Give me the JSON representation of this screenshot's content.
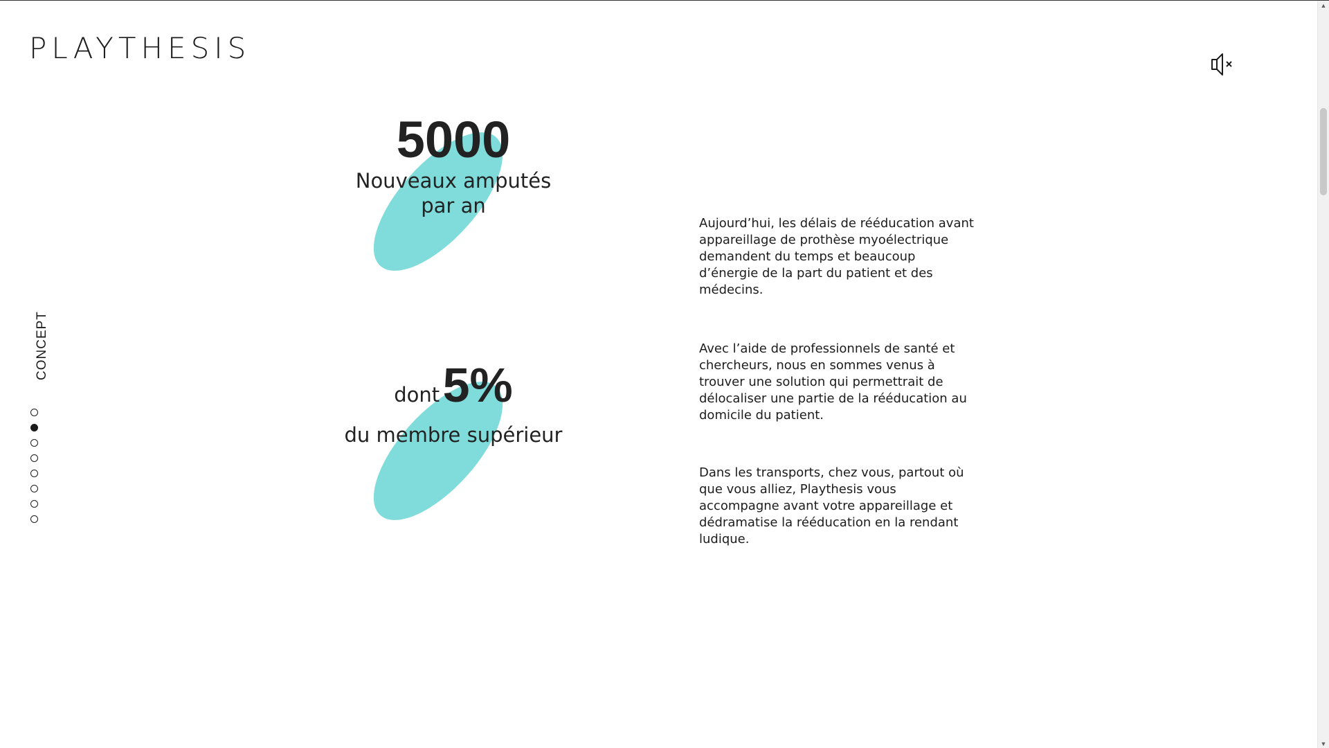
{
  "header": {
    "logo_text": "PLAYTHESIS",
    "sound_icon": "speaker-muted-icon"
  },
  "nav": {
    "section_label": "CONCEPT",
    "dots_total": 8,
    "active_index": 1
  },
  "stats": {
    "stat1": {
      "number": "5000",
      "label": "Nouveaux amputés par an"
    },
    "stat2": {
      "prefix": "dont",
      "number": "5%",
      "label": "du membre supérieur"
    }
  },
  "paragraphs": {
    "p1": "Aujourd’hui, les délais de rééducation avant appareillage de prothèse myoélectrique demandent du temps et beaucoup d’énergie de la part du patient et des médecins.",
    "p2": "Avec l’aide de professionnels de santé et chercheurs, nous en sommes venus à trouver une solution qui permettrait de délocaliser une partie de la rééducation au domicile du patient.",
    "p3": "Dans les transports, chez vous, partout où que vous alliez, Playthesis vous accompagne avant votre appareillage et dédramatise la rééducation en la rendant ludique."
  },
  "colors": {
    "accent": "#7fdcdb",
    "text": "#1c1c1c"
  }
}
